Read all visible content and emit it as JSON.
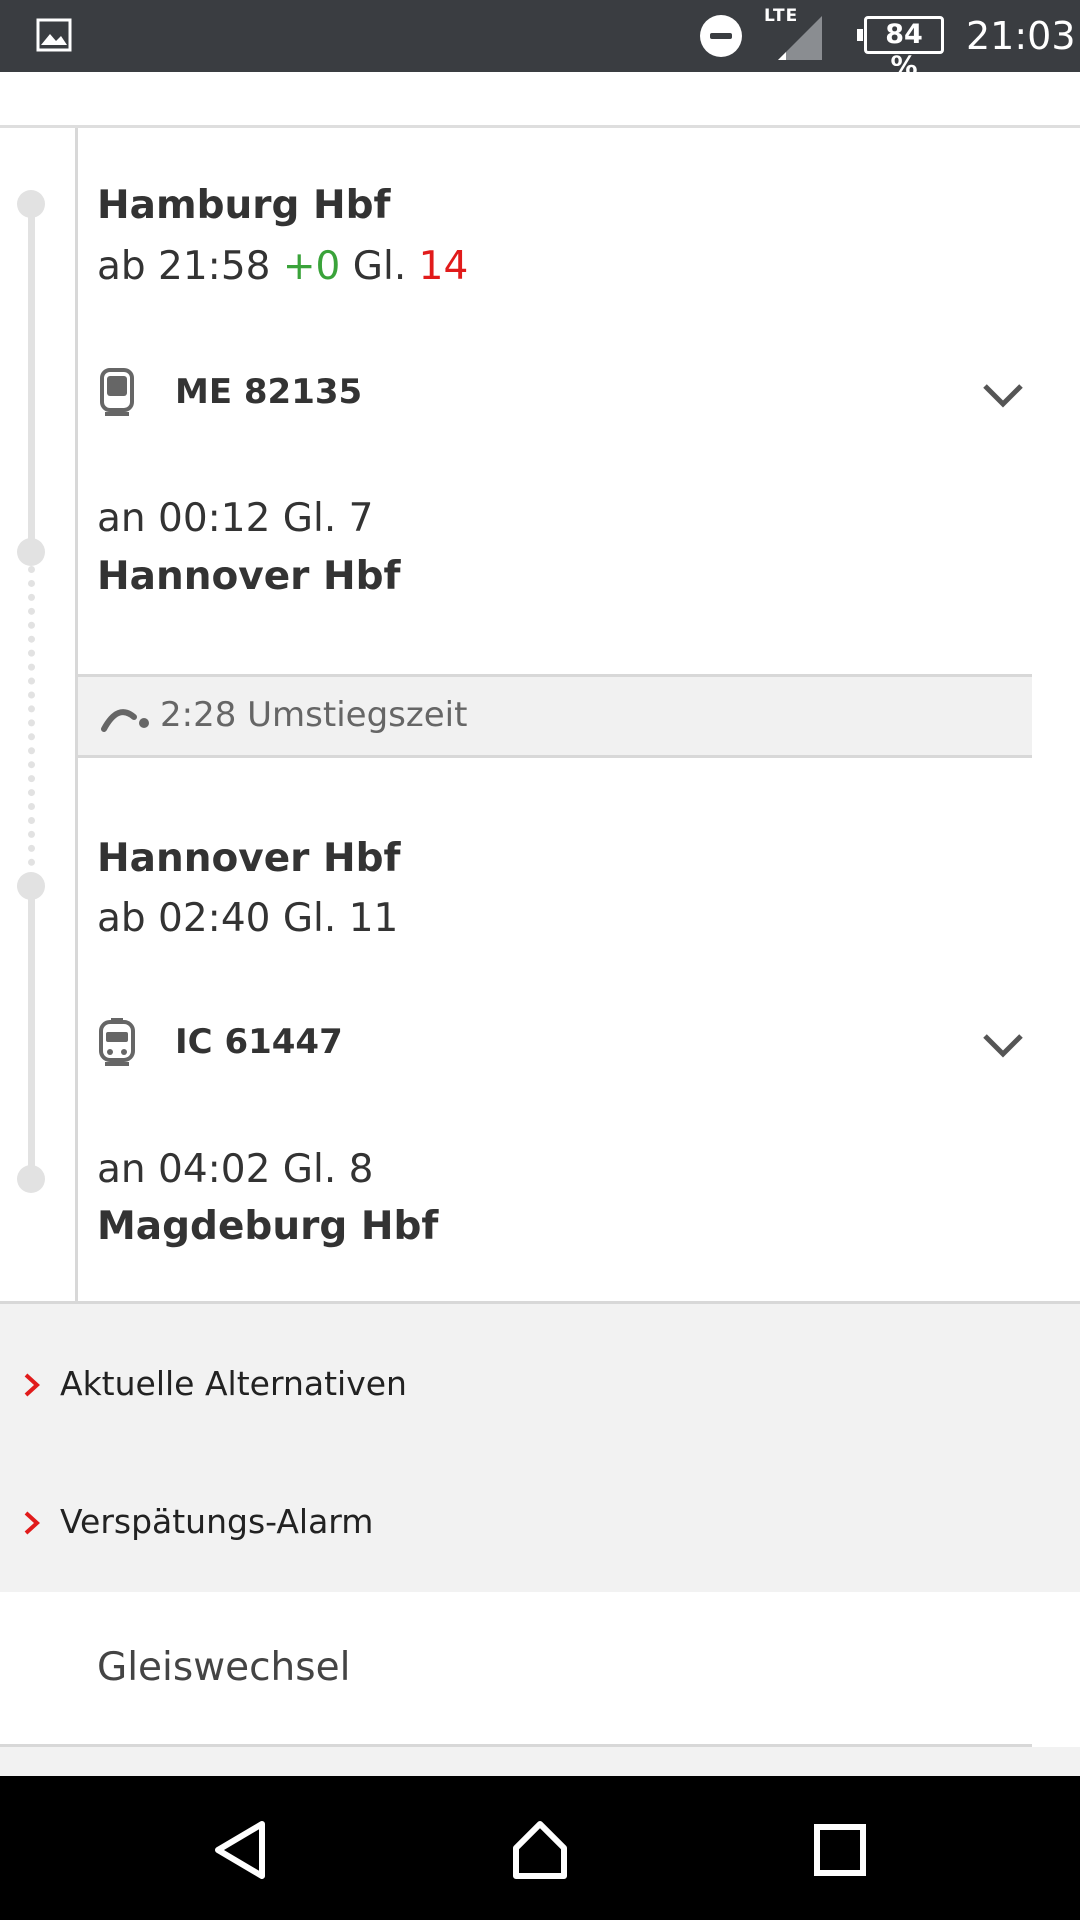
{
  "status_bar": {
    "lte": "LTE",
    "battery": "84 %",
    "time": "21:03"
  },
  "journey": {
    "leg1": {
      "from_station": "Hamburg Hbf",
      "dep_prefix": "ab 21:58",
      "dep_delay": "+0",
      "dep_platform_label": "Gl.",
      "dep_platform": "14",
      "train": "ME 82135",
      "arrival": "an 00:12 Gl. 7",
      "to_station": "Hannover Hbf"
    },
    "transfer": {
      "text": "2:28 Umstiegszeit"
    },
    "leg2": {
      "from_station": "Hannover Hbf",
      "departure": "ab 02:40 Gl. 11",
      "train": "IC 61447",
      "arrival": "an 04:02 Gl. 8",
      "to_station": "Magdeburg Hbf"
    }
  },
  "options": [
    {
      "label": "Aktuelle Alternativen"
    },
    {
      "label": "Verspätungs-Alarm"
    }
  ],
  "gleiswechsel": "Gleiswechsel",
  "colors": {
    "accent_red": "#e11b1b",
    "on_time_green": "#3aa33a",
    "status_bar": "#3a3d41"
  },
  "icons": {
    "gallery": "image-icon",
    "dnd": "do-not-disturb-icon",
    "signal": "signal-icon",
    "battery": "battery-icon",
    "train1": "regional-train-icon",
    "train2": "intercity-train-icon",
    "transfer": "transfer-walk-icon",
    "expand": "chevron-down-icon",
    "option": "chevron-right-icon",
    "back": "back-icon",
    "home": "home-icon",
    "recents": "recents-icon"
  }
}
